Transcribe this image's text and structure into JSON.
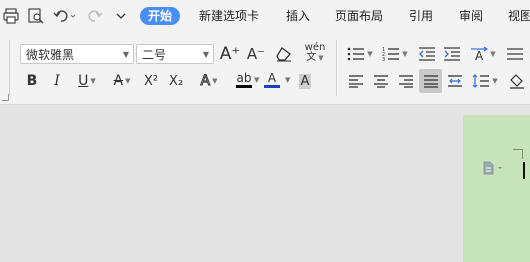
{
  "tabs": [
    {
      "label": "开始",
      "active": true
    },
    {
      "label": "新建选项卡"
    },
    {
      "label": "插入"
    },
    {
      "label": "页面布局"
    },
    {
      "label": "引用"
    },
    {
      "label": "审阅"
    },
    {
      "label": "视图"
    }
  ],
  "font": {
    "name": "微软雅黑",
    "size": "二号"
  },
  "glyphs": {
    "bold": "B",
    "italic": "I",
    "underline": "U",
    "strike": "A",
    "superscript": "X²",
    "subscript": "X₂",
    "text_effect": "A",
    "highlight": "ab",
    "font_color": "A",
    "char_shading": "A",
    "grow": "A⁺",
    "shrink": "A⁻",
    "phonetic": "wén"
  },
  "colors": {
    "accent": "#4b8df8",
    "font_color_bar": "#1f3fbf",
    "highlight_bar": "#000000",
    "page": "#c7e3ba"
  }
}
